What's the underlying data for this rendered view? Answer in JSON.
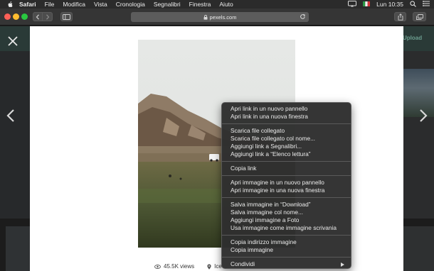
{
  "menubar": {
    "items": [
      "Safari",
      "File",
      "Modifica",
      "Vista",
      "Cronologia",
      "Segnalibri",
      "Finestra",
      "Aiuto"
    ],
    "clock": "Lun 10:35"
  },
  "toolbar": {
    "url": "pexels.com"
  },
  "page": {
    "upload_label": "Upload",
    "views": "45.5K views",
    "location": "Ice"
  },
  "context_menu": {
    "groups": [
      [
        "Apri link in un nuovo pannello",
        "Apri link in una nuova finestra"
      ],
      [
        "Scarica file collegato",
        "Scarica file collegato col nome...",
        "Aggiungi link a Segnalibri...",
        "Aggiungi link a “Elenco lettura”"
      ],
      [
        "Copia link"
      ],
      [
        "Apri immagine in un nuovo pannello",
        "Apri immagine in una nuova finestra"
      ],
      [
        "Salva immagine in “Download”",
        "Salva immagine col nome...",
        "Aggiungi immagine a Foto",
        "Usa immagine come immagine scrivania"
      ],
      [
        "Copia indirizzo immagine",
        "Copia immagine"
      ],
      [
        "Condividi"
      ]
    ]
  },
  "colors": {
    "menubar_bg": "#2b2b2b",
    "toolbar_bg": "#353535",
    "menu_bg": "#2e2e2e",
    "traffic_red": "#fd5f57",
    "traffic_yellow": "#fdbc2f",
    "traffic_green": "#29c840",
    "brand_accent": "#05a081"
  },
  "icons": {
    "apple": "apple-logo-icon",
    "close": "close-icon",
    "prev": "chevron-left-icon",
    "next": "chevron-right-icon",
    "views": "eye-icon",
    "location": "map-pin-icon",
    "submenu": "submenu-arrow-icon"
  }
}
